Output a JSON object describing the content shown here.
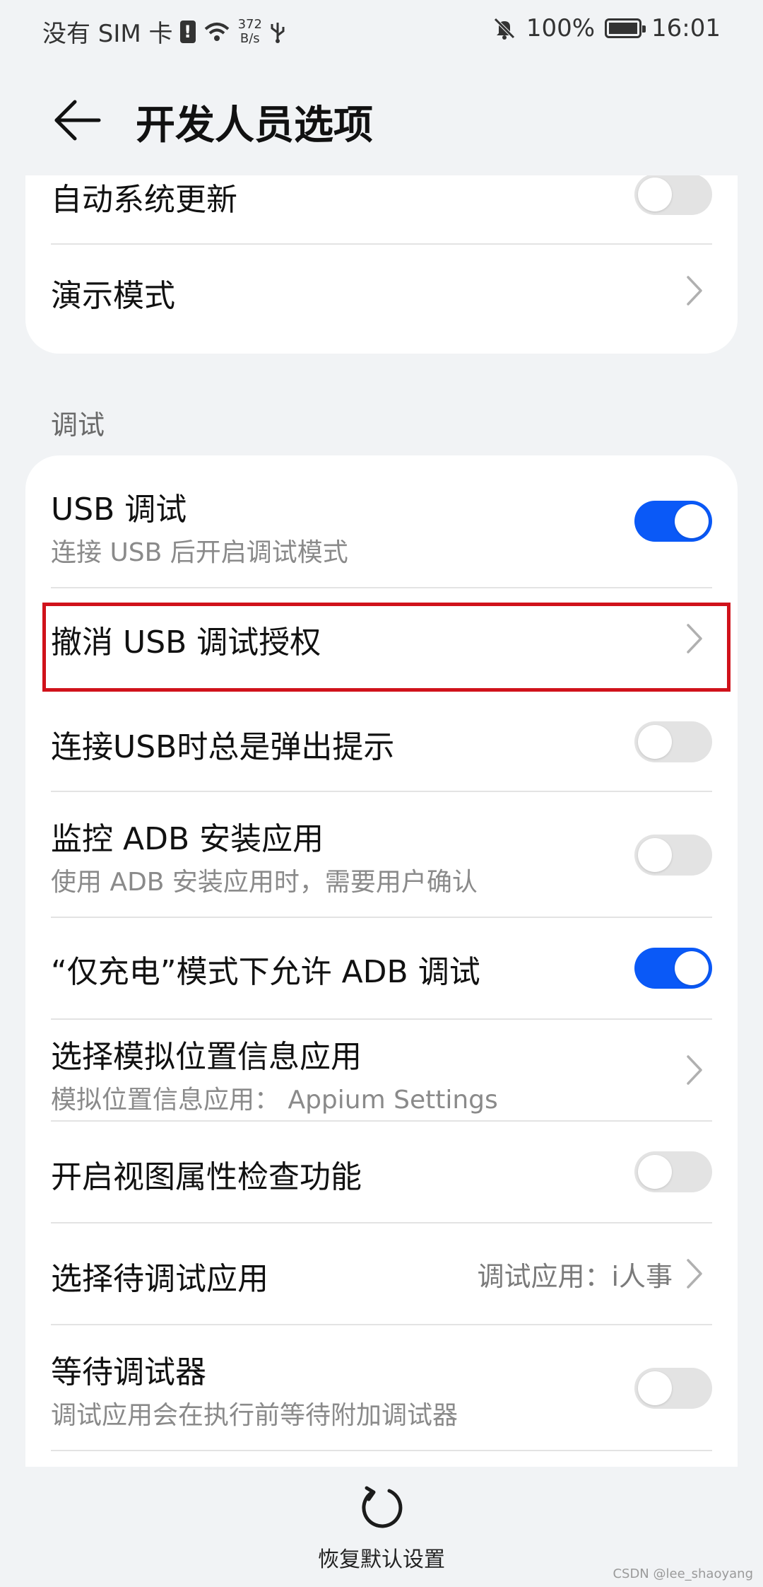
{
  "status_bar": {
    "carrier": "没有 SIM 卡",
    "sim_alert_glyph": "!",
    "net_speed_value": "372",
    "net_speed_unit": "B/s",
    "battery": "100%",
    "time": "16:01"
  },
  "header": {
    "title": "开发人员选项"
  },
  "top_card": {
    "auto_update": {
      "title": "自动系统更新",
      "enabled": false
    },
    "demo_mode": {
      "title": "演示模式"
    }
  },
  "debug_section": {
    "label": "调试",
    "items": [
      {
        "title": "USB 调试",
        "subtitle": "连接 USB 后开启调试模式",
        "enabled": true
      },
      {
        "title": "撤消 USB 调试授权"
      },
      {
        "title": "连接USB时总是弹出提示",
        "enabled": false
      },
      {
        "title": "监控 ADB 安装应用",
        "subtitle": "使用 ADB 安装应用时，需要用户确认",
        "enabled": false
      },
      {
        "title": "“仅充电”模式下允许 ADB 调试",
        "enabled": true
      },
      {
        "title": "选择模拟位置信息应用",
        "subtitle": "模拟位置信息应用： Appium Settings"
      },
      {
        "title": "开启视图属性检查功能",
        "enabled": false
      },
      {
        "title": "选择待调试应用",
        "value": "调试应用：i人事"
      },
      {
        "title": "等待调试器",
        "subtitle": "调试应用会在执行前等待附加调试器",
        "enabled": false
      }
    ]
  },
  "bottom": {
    "restore_label": "恢复默认设置",
    "watermark": "CSDN @lee_shaoyang"
  },
  "colors": {
    "accent": "#0a59f7",
    "highlight": "#d0121b",
    "background": "#f1f3f5"
  }
}
